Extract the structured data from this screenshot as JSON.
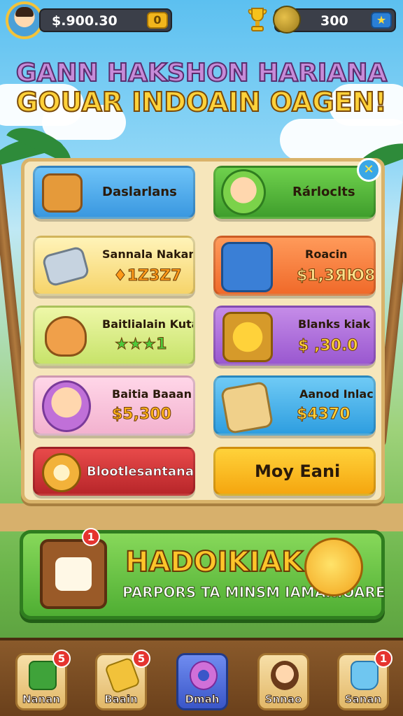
{
  "top_bar": {
    "coins": "$.900.30",
    "coins_add": "0",
    "gems": "300"
  },
  "title": {
    "line1": "GANN HAKSHON HARIANA",
    "line2": "GOUAR INDOAIN OAGEN!"
  },
  "cards": [
    {
      "label": "Daslarlans",
      "value": ""
    },
    {
      "label": "Rárloclts",
      "value": ""
    },
    {
      "label": "Sannala Nakan",
      "value": "♦1Z3Z7"
    },
    {
      "label": "Roacin",
      "value": "$1,3ЯЮ8"
    },
    {
      "label": "Baitlialain Kutan",
      "value": "★★★1"
    },
    {
      "label": "Blanks kiak",
      "value": "$ ,30.0"
    },
    {
      "label": "Baitia Baaan",
      "value": "$5,300"
    },
    {
      "label": "Aanod Inlacian",
      "value": "$4370"
    },
    {
      "label": "Blootlesantana",
      "value": ""
    },
    {
      "label": "Moy Eani",
      "value": ""
    }
  ],
  "banner": {
    "title": "HADOIKIAK",
    "subtitle": "PARPORS TA MINSM IAMANIOARE",
    "left_badge": "1"
  },
  "bottom_nav": [
    {
      "label": "Nanan",
      "badge": "5"
    },
    {
      "label": "Baain",
      "badge": "5"
    },
    {
      "label": "Dmah",
      "badge": ""
    },
    {
      "label": "Snnao",
      "badge": ""
    },
    {
      "label": "Sanan",
      "badge": "1"
    }
  ],
  "colors": {
    "accent_gold": "#ffd23a",
    "panel_bg": "#f6e6bb",
    "banner_green": "#4fae33"
  }
}
